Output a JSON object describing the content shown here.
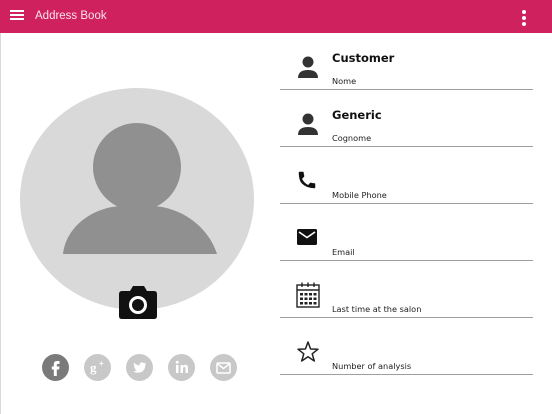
{
  "appbar": {
    "title": "Address Book",
    "color": "#d0215f",
    "menu_icon": "hamburger-menu-icon",
    "more_icon": "more-vert-icon"
  },
  "profile": {
    "avatar_icon": "person-placeholder-icon",
    "camera_icon": "camera-icon",
    "socials": [
      {
        "name": "facebook",
        "glyph": "f",
        "active": true
      },
      {
        "name": "google-plus",
        "glyph": "g+",
        "active": false
      },
      {
        "name": "twitter",
        "glyph": "twitter",
        "active": false
      },
      {
        "name": "linkedin",
        "glyph": "in",
        "active": false
      },
      {
        "name": "email",
        "glyph": "mail",
        "active": false
      }
    ]
  },
  "fields": [
    {
      "icon": "person-icon",
      "value": "Customer",
      "label": "Nome"
    },
    {
      "icon": "person-icon",
      "value": "Generic",
      "label": "Cognome"
    },
    {
      "icon": "phone-icon",
      "value": "",
      "label": "Mobile Phone"
    },
    {
      "icon": "email-icon",
      "value": "",
      "label": "Email"
    },
    {
      "icon": "calendar-icon",
      "value": "",
      "label": "Last time at the salon"
    },
    {
      "icon": "star-icon",
      "value": "",
      "label": "Number of analysis"
    }
  ]
}
